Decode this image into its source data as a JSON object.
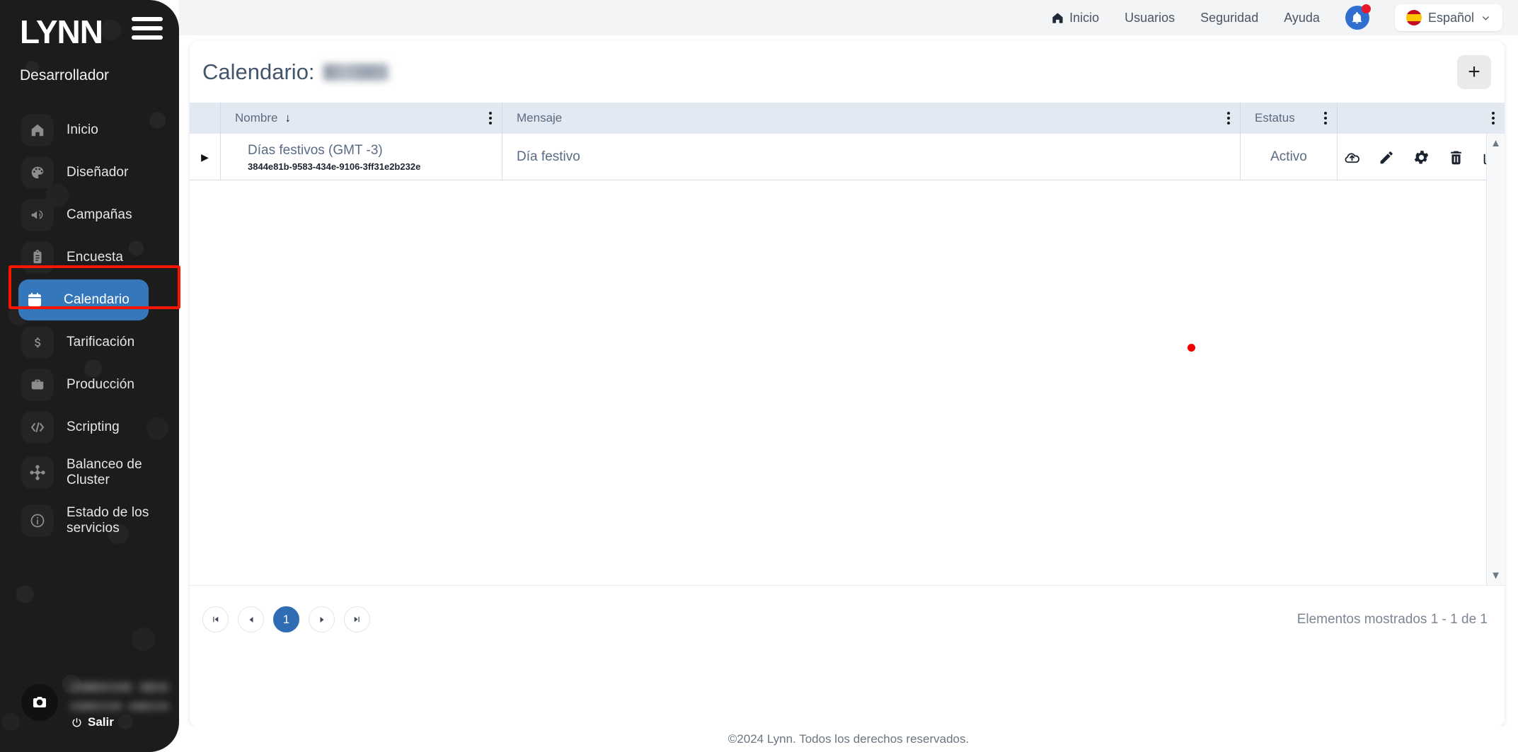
{
  "brand": {
    "logo_text": "LYNN",
    "subtitle": "Desarrollador",
    "menu_icon": "hamburger-menu-icon"
  },
  "sidebar": {
    "items": [
      {
        "label": "Inicio",
        "icon": "home-icon",
        "active": false
      },
      {
        "label": "Diseñador",
        "icon": "palette-icon",
        "active": false
      },
      {
        "label": "Campañas",
        "icon": "megaphone-icon",
        "active": false
      },
      {
        "label": "Encuesta",
        "icon": "clipboard-icon",
        "active": false
      },
      {
        "label": "Calendario",
        "icon": "calendar-icon",
        "active": true
      },
      {
        "label": "Tarificación",
        "icon": "dollar-icon",
        "active": false
      },
      {
        "label": "Producción",
        "icon": "briefcase-icon",
        "active": false
      },
      {
        "label": "Scripting",
        "icon": "code-icon",
        "active": false
      },
      {
        "label": "Balanceo de Cluster",
        "icon": "cluster-icon",
        "active": false
      },
      {
        "label": "Estado de los servicios",
        "icon": "info-circle-icon",
        "active": false
      }
    ],
    "footer": {
      "avatar_icon": "camera-icon",
      "logout_label": "Salir",
      "logout_icon": "power-icon"
    }
  },
  "topnav": {
    "links": [
      {
        "label": "Inicio",
        "icon": "home-icon"
      },
      {
        "label": "Usuarios",
        "icon": ""
      },
      {
        "label": "Seguridad",
        "icon": ""
      },
      {
        "label": "Ayuda",
        "icon": ""
      }
    ],
    "notifications": {
      "icon": "bell-icon",
      "has_unread": true
    },
    "language": {
      "label": "Español",
      "flag": "flag-spain-icon",
      "chevron": "chevron-down-icon"
    }
  },
  "page": {
    "title_prefix": "Calendario:",
    "title_value_redacted": true,
    "add_button_label": "+",
    "add_button_icon": "plus-icon"
  },
  "table": {
    "columns": [
      {
        "key": "expander",
        "label": ""
      },
      {
        "key": "nombre",
        "label": "Nombre",
        "sort": "desc",
        "sort_icon": "arrow-down-icon",
        "menu_icon": "kebab-menu-icon"
      },
      {
        "key": "mensaje",
        "label": "Mensaje",
        "menu_icon": "kebab-menu-icon"
      },
      {
        "key": "estatus",
        "label": "Estatus",
        "menu_icon": "kebab-menu-icon"
      },
      {
        "key": "acciones",
        "label": "",
        "menu_icon": "kebab-menu-icon"
      }
    ],
    "rows": [
      {
        "expander_icon": "triangle-right-icon",
        "nombre": "Días festivos (GMT -3)",
        "uuid": "3844e81b-9583-434e-9106-3ff31e2b232e",
        "mensaje": "Día festivo",
        "estatus": "Activo",
        "actions": [
          {
            "name": "cloud-upload-icon"
          },
          {
            "name": "pencil-edit-icon"
          },
          {
            "name": "gear-settings-icon"
          },
          {
            "name": "trash-delete-icon"
          },
          {
            "name": "copy-duplicate-icon"
          }
        ]
      }
    ],
    "scrollbar": {
      "up_icon": "triangle-up-icon",
      "down_icon": "triangle-down-icon"
    }
  },
  "pagination": {
    "first_icon": "skip-first-icon",
    "prev_icon": "triangle-left-icon",
    "pages": [
      "1"
    ],
    "current_page": "1",
    "next_icon": "triangle-right-icon",
    "last_icon": "skip-last-icon",
    "info": "Elementos mostrados 1 - 1 de 1"
  },
  "footer": {
    "copyright": "©2024 Lynn. Todos los derechos reservados."
  },
  "colors": {
    "accent_blue": "#3577bb",
    "pager_blue": "#2e6db4",
    "annotation_red": "#fa1500",
    "sidebar_bg": "#1c1c1c",
    "header_row": "#e3e9f2"
  }
}
